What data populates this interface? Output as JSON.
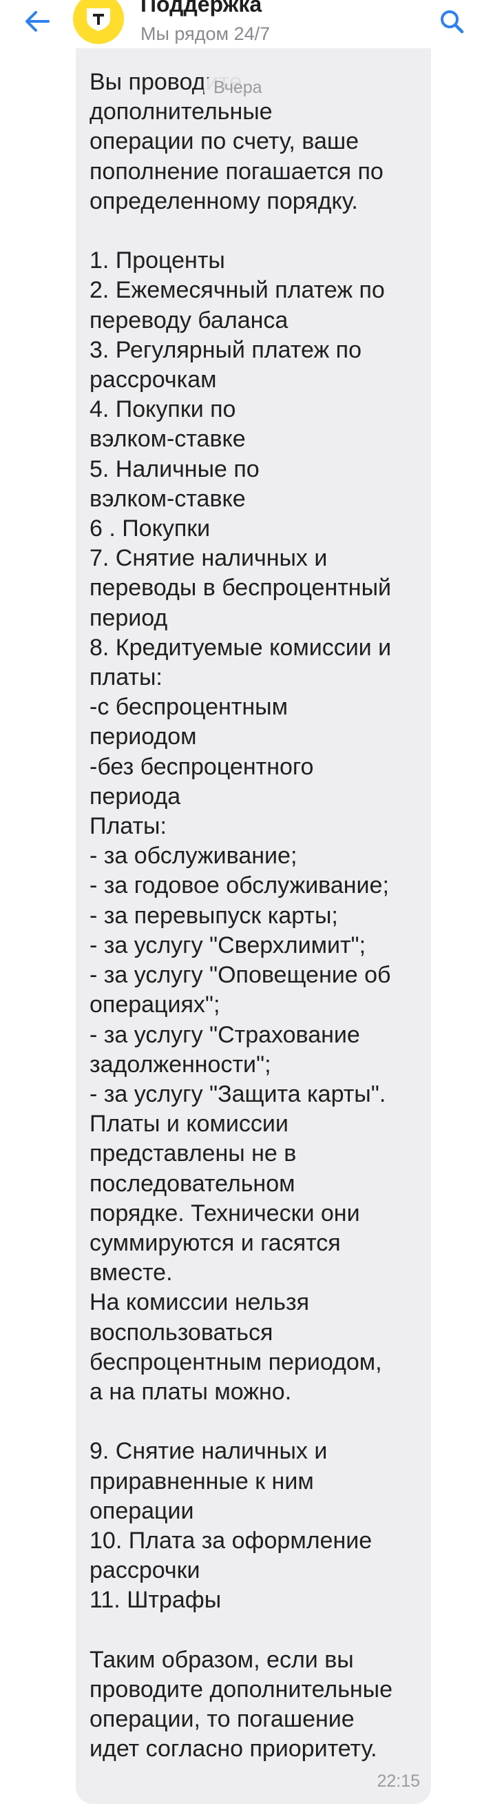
{
  "header": {
    "title": "Поддержка",
    "subtitle": "Мы рядом 24/7",
    "icons": {
      "back": "arrow-left-icon",
      "search": "search-icon",
      "avatar": "tinkoff-shield-logo"
    },
    "accent_color": "#2f80ed",
    "avatar_color": "#ffdd2d"
  },
  "date_chip": "Вчера",
  "message": {
    "text": "Вы проводите\nдополнительные\nоперации по счету, ваше\nпополнение погашается по\nопределенному порядку.\n\n1. Проценты\n2. Ежемесячный платеж по\nпереводу баланса\n3. Регулярный платеж по\nрассрочкам\n4. Покупки по\nвэлком-ставке\n5. Наличные по\nвэлком-ставке\n6 . Покупки\n7. Снятие наличных и\nпереводы в беспроцентный\nпериод\n8. Кредитуемые комиссии и\nплаты:\n-с беспроцентным\nпериодом\n-без беспроцентного\nпериода\nПлаты:\n- за обслуживание;\n- за годовое обслуживание;\n- за перевыпуск карты;\n- за услугу \"Сверхлимит\";\n- за услугу \"Оповещение об\nоперациях\";\n- за услугу \"Страхование\nзадолженности\";\n- за услугу \"Защита карты\".\nПлаты и комиссии\nпредставлены не в\nпоследовательном\nпорядке. Технически они\nсуммируются и гасятся\nвместе.\nНа комиссии нельзя\nвоспользоваться\nбеспроцентным периодом,\nа на платы можно.\n\n9. Снятие наличных и\nприравненные к ним\nоперации\n10. Плата за оформление\nрассрочки\n11. Штрафы\n\nТаким образом, если вы\nпроводите дополнительные\nоперации, то погашение\nидет согласно приоритету.",
    "time": "22:15",
    "bubble_color": "#eeeef0"
  }
}
